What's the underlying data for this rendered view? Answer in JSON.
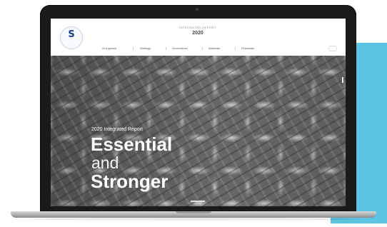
{
  "colors": {
    "accent_panel": "#5bc4e3",
    "laptop_frame": "#1a1a1a",
    "logo_blue": "#12418a"
  },
  "header": {
    "logo_letter": "S",
    "logo_subtext": "",
    "kicker": "INTEGRATED REPORT",
    "year": "2020"
  },
  "nav": {
    "items": [
      "At a glance",
      "Strategy",
      "Governance",
      "Materials",
      "Financials"
    ]
  },
  "hero": {
    "kicker": "2020 Integrated Report",
    "line1": "Essential",
    "line2": "and",
    "line3": "Stronger"
  },
  "icons": {
    "logo": "company-logo",
    "search": "search-icon",
    "camera": "camera-icon"
  }
}
